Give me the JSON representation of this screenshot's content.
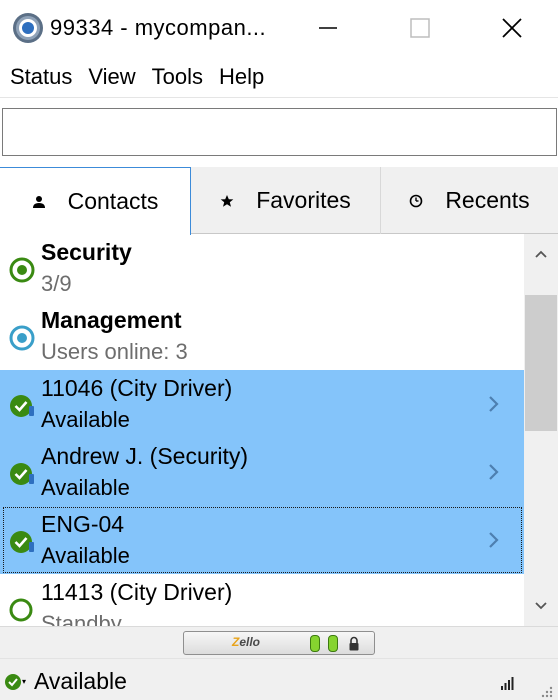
{
  "window": {
    "title": "99334 - mycompan...",
    "icon": "zello-app-icon",
    "controls": [
      "minimize-icon",
      "maximize-icon",
      "close-icon"
    ]
  },
  "menu": {
    "items": [
      "Status",
      "View",
      "Tools",
      "Help"
    ]
  },
  "search": {
    "value": "",
    "placeholder": ""
  },
  "tabs": [
    {
      "label": "Contacts",
      "icon": "person-icon",
      "active": true
    },
    {
      "label": "Favorites",
      "icon": "star-icon",
      "active": false
    },
    {
      "label": "Recents",
      "icon": "clock-icon",
      "active": false
    }
  ],
  "contacts": [
    {
      "name": "Security",
      "sub": "3/9",
      "type": "channel",
      "status_icon": "channel-online-icon",
      "bold": true,
      "selected": false
    },
    {
      "name": "Management",
      "sub": "Users online: 3",
      "type": "channel",
      "status_icon": "channel-blue-icon",
      "bold": true,
      "selected": false
    },
    {
      "name": "11046 (City Driver)",
      "sub": "Available",
      "type": "user",
      "status_icon": "available-check-icon",
      "bold": false,
      "selected": true
    },
    {
      "name": "Andrew J. (Security)",
      "sub": "Available",
      "type": "user",
      "status_icon": "available-check-icon",
      "bold": false,
      "selected": true
    },
    {
      "name": "ENG-04",
      "sub": "Available",
      "type": "user",
      "status_icon": "available-check-icon",
      "bold": false,
      "selected": true,
      "focused": true
    },
    {
      "name": "11413 (City Driver)",
      "sub": "Standby",
      "type": "user",
      "status_icon": "standby-ring-icon",
      "bold": false,
      "selected": false
    }
  ],
  "ptt_bar": {
    "logo_text": "Zello"
  },
  "status_bar": {
    "status": "Available",
    "status_icon": "available-check-icon"
  },
  "colors": {
    "selected_row": "#84c4fa",
    "online_green": "#3a8a12",
    "channel_blue": "#3a9fc9",
    "active_tab_border": "#3c8bd9"
  }
}
